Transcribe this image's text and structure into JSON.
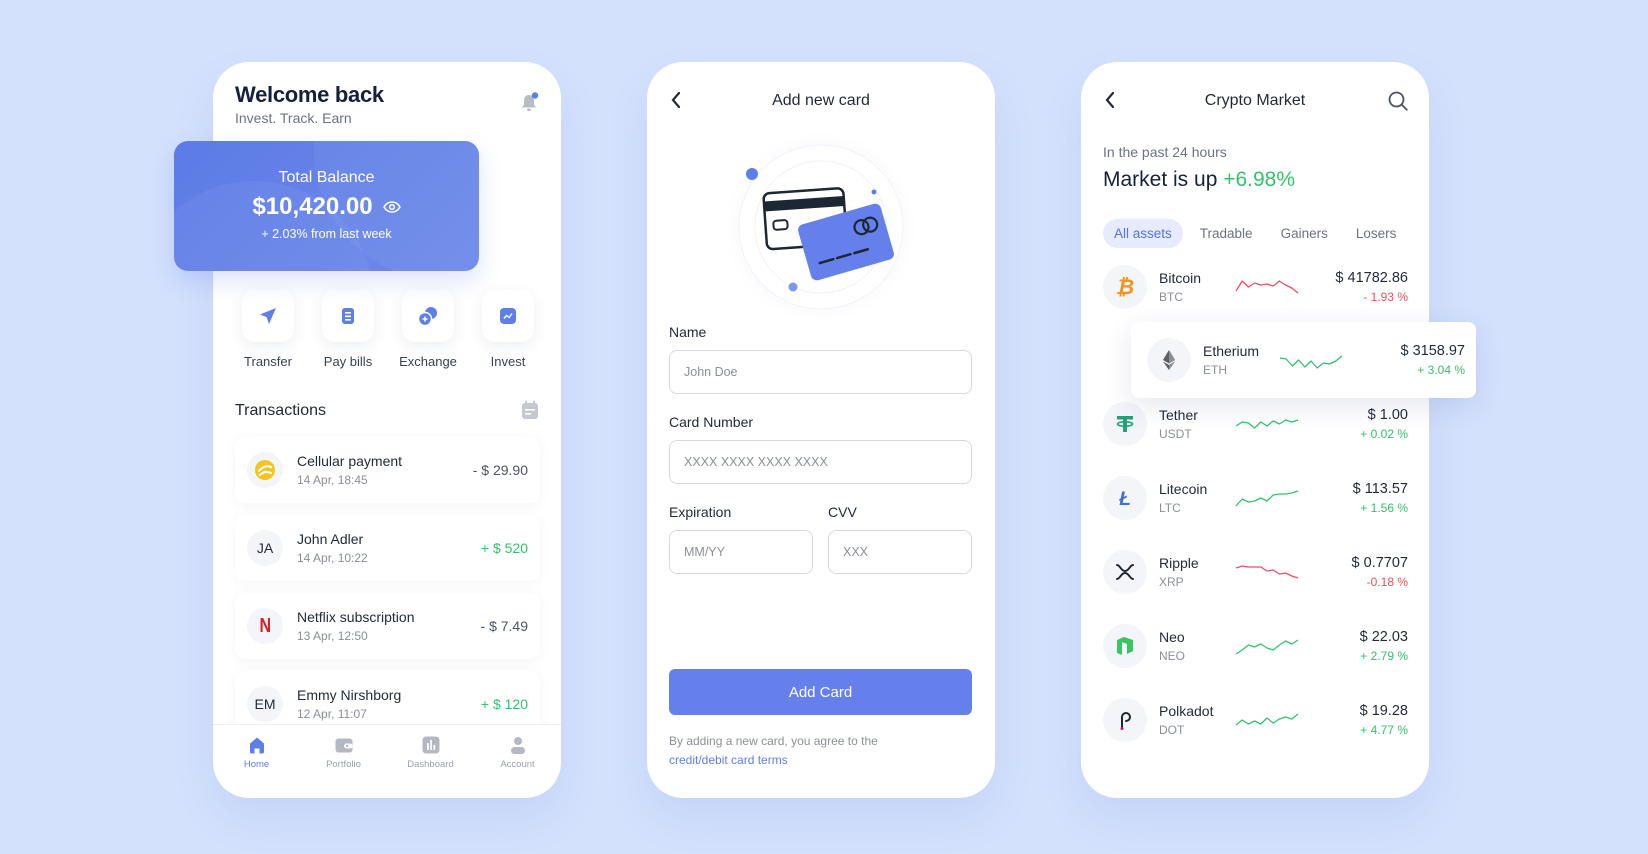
{
  "home": {
    "title": "Welcome back",
    "subtitle": "Invest. Track. Earn",
    "balance": {
      "label": "Total Balance",
      "amount": "$10,420.00",
      "change": "+ 2.03% from last week"
    },
    "actions": [
      {
        "label": "Transfer",
        "icon": "send-icon"
      },
      {
        "label": "Pay bills",
        "icon": "bill-icon"
      },
      {
        "label": "Exchange",
        "icon": "exchange-icon"
      },
      {
        "label": "Invest",
        "icon": "chart-icon"
      }
    ],
    "transactions_title": "Transactions",
    "transactions": [
      {
        "avatar": "",
        "name": "Cellular payment",
        "date": "14 Apr, 18:45",
        "amount": "- $ 29.90",
        "direction": "out"
      },
      {
        "avatar": "JA",
        "name": "John Adler",
        "date": "14 Apr, 10:22",
        "amount": "+ $ 520",
        "direction": "in"
      },
      {
        "avatar": "N",
        "name": "Netflix subscription",
        "date": "13 Apr, 12:50",
        "amount": "- $ 7.49",
        "direction": "out"
      },
      {
        "avatar": "EM",
        "name": "Emmy Nirshborg",
        "date": "12 Apr, 11:07",
        "amount": "+ $ 120",
        "direction": "in"
      }
    ],
    "nav": [
      {
        "label": "Home",
        "active": true
      },
      {
        "label": "Portfolio",
        "active": false
      },
      {
        "label": "Dashboard",
        "active": false
      },
      {
        "label": "Account",
        "active": false
      }
    ]
  },
  "add_card": {
    "title": "Add new card",
    "fields": {
      "name_label": "Name",
      "name_placeholder": "John Doe",
      "number_label": "Card Number",
      "number_placeholder": "XXXX XXXX XXXX XXXX",
      "expiration_label": "Expiration",
      "expiration_placeholder": "MM/YY",
      "cvv_label": "CVV",
      "cvv_placeholder": "XXX"
    },
    "button": "Add Card",
    "terms_text": "By adding a new card, you agree to the",
    "terms_link": "credit/debit card terms"
  },
  "crypto": {
    "title": "Crypto Market",
    "period": "In the past 24 hours",
    "market_label": "Market is up",
    "market_change": "+6.98%",
    "tabs": [
      "All assets",
      "Tradable",
      "Gainers",
      "Losers"
    ],
    "active_tab": "All assets",
    "coins": [
      {
        "name": "Bitcoin",
        "symbol": "BTC",
        "price": "$ 41782.86",
        "change": "- 1.93 %",
        "trend": "down",
        "spark": [
          0.3,
          0.8,
          0.5,
          0.7,
          0.6,
          0.65,
          0.55,
          0.8,
          0.6,
          0.45,
          0.2
        ]
      },
      {
        "name": "Etherium",
        "symbol": "ETH",
        "price": "$ 3158.97",
        "change": "+ 3.04 %",
        "trend": "up",
        "spark": [
          0.6,
          0.55,
          0.2,
          0.5,
          0.15,
          0.45,
          0.1,
          0.35,
          0.3,
          0.45,
          0.7
        ]
      },
      {
        "name": "Tether",
        "symbol": "USDT",
        "price": "$ 1.00",
        "change": "+ 0.02 %",
        "trend": "up",
        "spark": [
          0.4,
          0.6,
          0.55,
          0.3,
          0.6,
          0.4,
          0.65,
          0.5,
          0.7,
          0.6,
          0.7
        ]
      },
      {
        "name": "Litecoin",
        "symbol": "LTC",
        "price": "$ 113.57",
        "change": "+ 1.56 %",
        "trend": "up",
        "spark": [
          0.1,
          0.45,
          0.3,
          0.35,
          0.5,
          0.35,
          0.65,
          0.7,
          0.7,
          0.75,
          0.85
        ]
      },
      {
        "name": "Ripple",
        "symbol": "XRP",
        "price": "$ 0.7707",
        "change": "-0.18 %",
        "trend": "down",
        "spark": [
          0.7,
          0.8,
          0.75,
          0.75,
          0.75,
          0.55,
          0.6,
          0.4,
          0.45,
          0.3,
          0.2
        ]
      },
      {
        "name": "Neo",
        "symbol": "NEO",
        "price": "$ 22.03",
        "change": "+ 2.79 %",
        "trend": "up",
        "spark": [
          0.1,
          0.3,
          0.55,
          0.45,
          0.6,
          0.4,
          0.3,
          0.55,
          0.75,
          0.6,
          0.8
        ]
      },
      {
        "name": "Polkadot",
        "symbol": "DOT",
        "price": "$ 19.28",
        "change": "+ 4.77 %",
        "trend": "up",
        "spark": [
          0.25,
          0.5,
          0.3,
          0.45,
          0.3,
          0.6,
          0.35,
          0.55,
          0.65,
          0.55,
          0.8
        ]
      }
    ]
  },
  "colors": {
    "background": "#d3e1fd",
    "accent": "#6580ea",
    "positive": "#34c26b",
    "negative": "#ef4e5e",
    "heading": "#14213d"
  }
}
